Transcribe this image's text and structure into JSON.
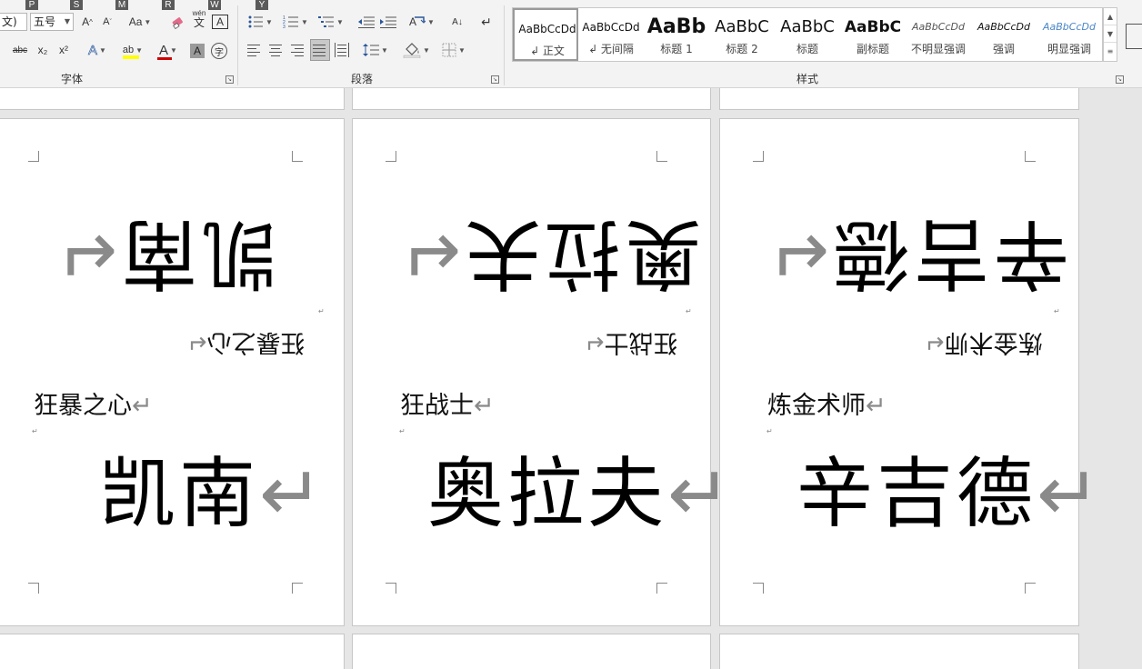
{
  "ribbon": {
    "keytips": [
      "P",
      "S",
      "M",
      "R",
      "W",
      "Y"
    ],
    "font": {
      "name_value": "文)",
      "size_value": "五号",
      "group_label": "字体",
      "grow_label": "A",
      "shrink_label": "A",
      "case_label": "Aa",
      "strike_label": "abc",
      "sub_label": "x₂",
      "sup_label": "x²",
      "effects_label": "A",
      "highlight_label": "ab",
      "color_label": "A",
      "shade_label": "A",
      "enclose_label": "字",
      "phonetic_label": "wén",
      "phonetic_sub": "文",
      "border_label": "A"
    },
    "paragraph": {
      "group_label": "段落",
      "sort_label": "A↓",
      "marks_label": "↵"
    },
    "styles": {
      "group_label": "样式",
      "items": [
        {
          "preview": "AaBbCcDd",
          "name": "↲ 正文"
        },
        {
          "preview": "AaBbCcDd",
          "name": "↲ 无间隔"
        },
        {
          "preview": "AaBb",
          "name": "标题 1"
        },
        {
          "preview": "AaBbC",
          "name": "标题 2"
        },
        {
          "preview": "AaBbC",
          "name": "标题"
        },
        {
          "preview": "AaBbC",
          "name": "副标题"
        },
        {
          "preview": "AaBbCcDd",
          "name": "不明显强调"
        },
        {
          "preview": "AaBbCcDd",
          "name": "强调"
        },
        {
          "preview": "AaBbCcDd",
          "name": "明显强调"
        }
      ]
    }
  },
  "cards": [
    {
      "name": "凯南",
      "title": "狂暴之心"
    },
    {
      "name": "奥拉夫",
      "title": "狂战士"
    },
    {
      "name": "辛吉德",
      "title": "炼金术师"
    }
  ],
  "marks": {
    "para": "↵",
    "flip_para": "↵",
    "tiny": "↵"
  },
  "colors": {
    "highlight": "#ffff00",
    "font_red": "#d00000",
    "accent_blue": "#2b579a"
  }
}
